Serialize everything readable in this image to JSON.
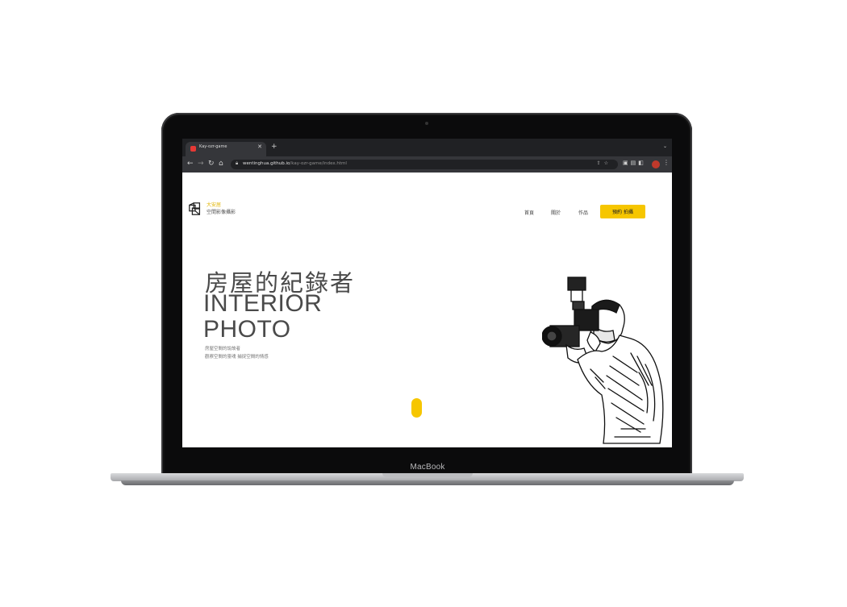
{
  "device": {
    "brand": "MacBook"
  },
  "browser": {
    "tab": {
      "title": "Kay-ozr-game"
    },
    "new_tab_label": "+",
    "tab_menu_label": "⌄",
    "url_host": "wentinghua.github.io",
    "url_path": "/kay-ozr-game/index.html"
  },
  "site": {
    "logo_name": "大安居",
    "logo_tagline": "空間影像攝影",
    "nav": [
      {
        "label": "首頁"
      },
      {
        "label": "關於"
      },
      {
        "label": "作品"
      }
    ],
    "cta_label": "預約 拍攝"
  },
  "hero": {
    "title_cn": "房屋的紀錄者",
    "title_en_line1": "INTERIOR",
    "title_en_line2": "PHOTO",
    "subtitle_line1": "房屋空間的說故者",
    "subtitle_line2": "觀察空間的靈魂 捕捉空間的情感"
  },
  "colors": {
    "accent": "#f6c600",
    "chrome": "#202124"
  },
  "icons": [
    "back-icon",
    "forward-icon",
    "reload-icon",
    "home-icon",
    "lock-icon",
    "share-icon",
    "star-icon",
    "extension-icon",
    "avatar",
    "menu-icon",
    "photographer-illustration"
  ]
}
